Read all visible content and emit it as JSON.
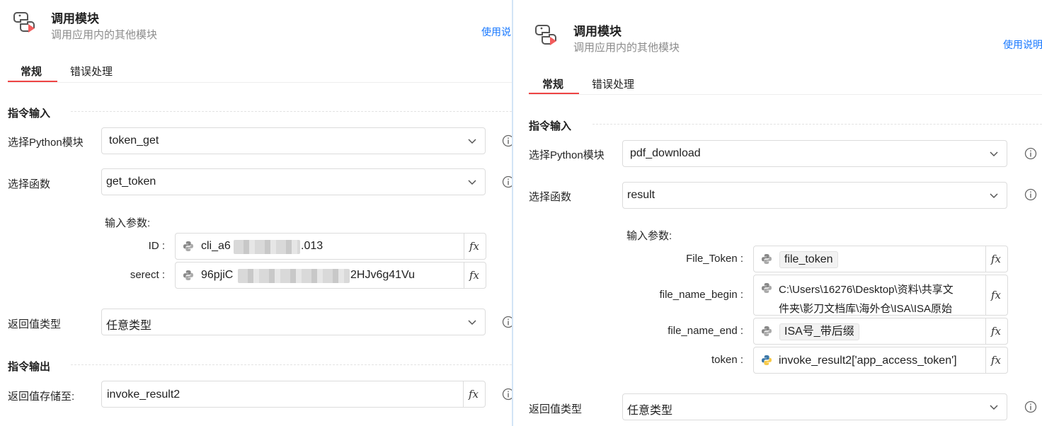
{
  "left": {
    "header": {
      "title": "调用模块",
      "subtitle": "调用应用内的其他模块",
      "help": "使用说"
    },
    "tabs": [
      {
        "label": "常规"
      },
      {
        "label": "错误处理"
      }
    ],
    "input_section": {
      "title": "指令输入"
    },
    "module": {
      "label": "选择Python模块",
      "value": "token_get"
    },
    "function": {
      "label": "选择函数",
      "value": "get_token"
    },
    "params": {
      "title": "输入参数:",
      "items": [
        {
          "label": "ID :",
          "value_start": "cli_a6",
          "value_end": ".013"
        },
        {
          "label": "serect :",
          "value_start": "96pjiC",
          "value_end": "2HJv6g41Vu"
        }
      ]
    },
    "return_type": {
      "label": "返回值类型",
      "value": "任意类型"
    },
    "output_section": {
      "title": "指令输出"
    },
    "store": {
      "label": "返回值存储至:",
      "value": "invoke_result2"
    },
    "fx": "fx"
  },
  "right": {
    "header": {
      "title": "调用模块",
      "subtitle": "调用应用内的其他模块",
      "help": "使用说明"
    },
    "tabs": [
      {
        "label": "常规"
      },
      {
        "label": "错误处理"
      }
    ],
    "input_section": {
      "title": "指令输入"
    },
    "module": {
      "label": "选择Python模块",
      "value": "pdf_download"
    },
    "function": {
      "label": "选择函数",
      "value": "result"
    },
    "params": {
      "title": "输入参数:",
      "items": [
        {
          "label": "File_Token :",
          "value": "file_token"
        },
        {
          "label": "file_name_begin :",
          "line1": "C:\\Users\\16276\\Desktop\\资料\\共享文",
          "line2": "件夹\\影刀文档库\\海外仓\\ISA\\ISA原始"
        },
        {
          "label": "file_name_end :",
          "value": "ISA号_带后缀"
        },
        {
          "label": "token :",
          "value": "invoke_result2['app_access_token']"
        }
      ]
    },
    "return_type": {
      "label": "返回值类型",
      "value": "任意类型"
    },
    "fx": "fx"
  }
}
